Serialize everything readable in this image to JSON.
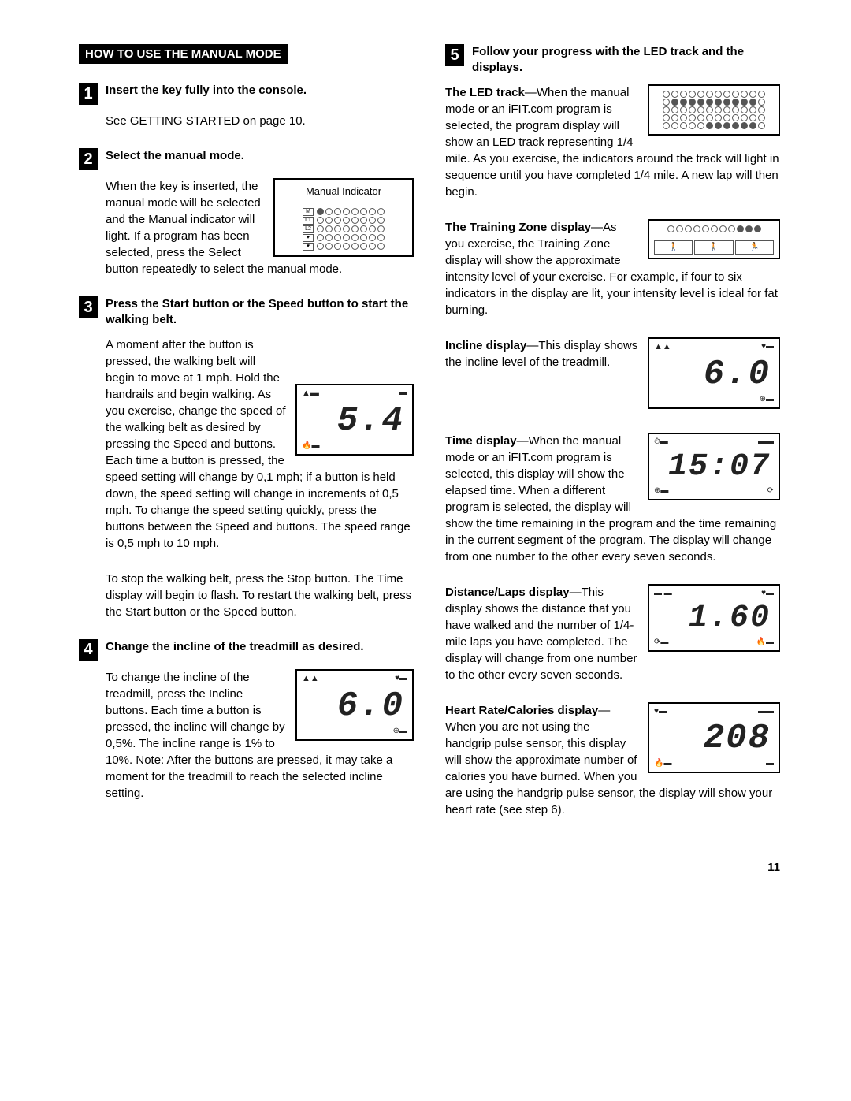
{
  "page_number": "11",
  "heading": "HOW TO USE THE MANUAL MODE",
  "left": {
    "step1": {
      "num": "1",
      "title": "Insert the key fully into the console.",
      "body": "See GETTING STARTED on page 10."
    },
    "step2": {
      "num": "2",
      "title": "Select the manual mode.",
      "fig_label": "Manual Indicator",
      "body": "When the key is inserted, the manual mode will be selected and the Manual indicator will light. If a program has been selected, press the Select button repeatedly to select the manual mode."
    },
    "step3": {
      "num": "3",
      "title": "Press the Start button or the Speed     button to start the walking belt.",
      "seg": "5.4",
      "body1": "A moment after the button is pressed, the walking belt will begin to move at 1 mph. Hold the handrails and begin walking. As you exercise, change the speed of the walking belt as desired by pressing the Speed    and     buttons. Each time a button is pressed, the speed setting will change by 0,1 mph; if a button is held down, the speed setting will change in increments of 0,5 mph. To change the speed setting quickly, press the buttons between the Speed     and     buttons. The speed range is 0,5 mph to 10 mph.",
      "body2": "To stop the walking belt, press the Stop button. The Time display will begin to flash. To restart the walking belt, press the Start button or the Speed    button."
    },
    "step4": {
      "num": "4",
      "title": "Change the incline of the treadmill as desired.",
      "seg": "6.0",
      "body": "To change the incline of the treadmill, press the Incline buttons. Each time a button is pressed, the incline will change by 0,5%. The incline range is 1% to 10%. Note: After the buttons are pressed, it may take a moment for the treadmill to reach the selected incline setting."
    }
  },
  "right": {
    "step5": {
      "num": "5",
      "title": "Follow your progress with the LED track and the displays."
    },
    "led": {
      "label": "The LED track",
      "body": "—When the manual mode or an iFIT.com program is selected, the program display will show an LED track representing 1/4 mile. As you exercise, the indicators around the track will light in sequence until you have completed 1/4 mile. A new lap will then begin."
    },
    "tz": {
      "label": "The Training Zone display",
      "body": "—As you exercise, the Training Zone display will show the approximate intensity level of your exercise. For example, if four to six indicators in the display are lit, your intensity level is ideal for fat burning."
    },
    "incline": {
      "label": "Incline display",
      "seg": "6.0",
      "body": "—This display shows the incline level of the treadmill."
    },
    "time": {
      "label": "Time display",
      "seg": "15:07",
      "body": "—When the manual mode or an iFIT.com program is selected, this display will show the elapsed time. When a different program is selected, the display will show the time remaining in the program and the time remaining in the current segment of the program. The display will change from one number to the other every seven seconds."
    },
    "dist": {
      "label": "Distance/Laps display",
      "seg": "1.60",
      "body": "—This display shows the distance that you have walked and the number of 1/4-mile laps you have completed. The display will change from one number to the other every seven seconds."
    },
    "hr": {
      "label": "Heart Rate/Calories display",
      "seg": "208",
      "body": "—When you are not using the handgrip pulse sensor, this display will show the approximate number of calories you have burned. When you are using the handgrip pulse sensor, the display will show your heart rate (see step 6)."
    }
  }
}
